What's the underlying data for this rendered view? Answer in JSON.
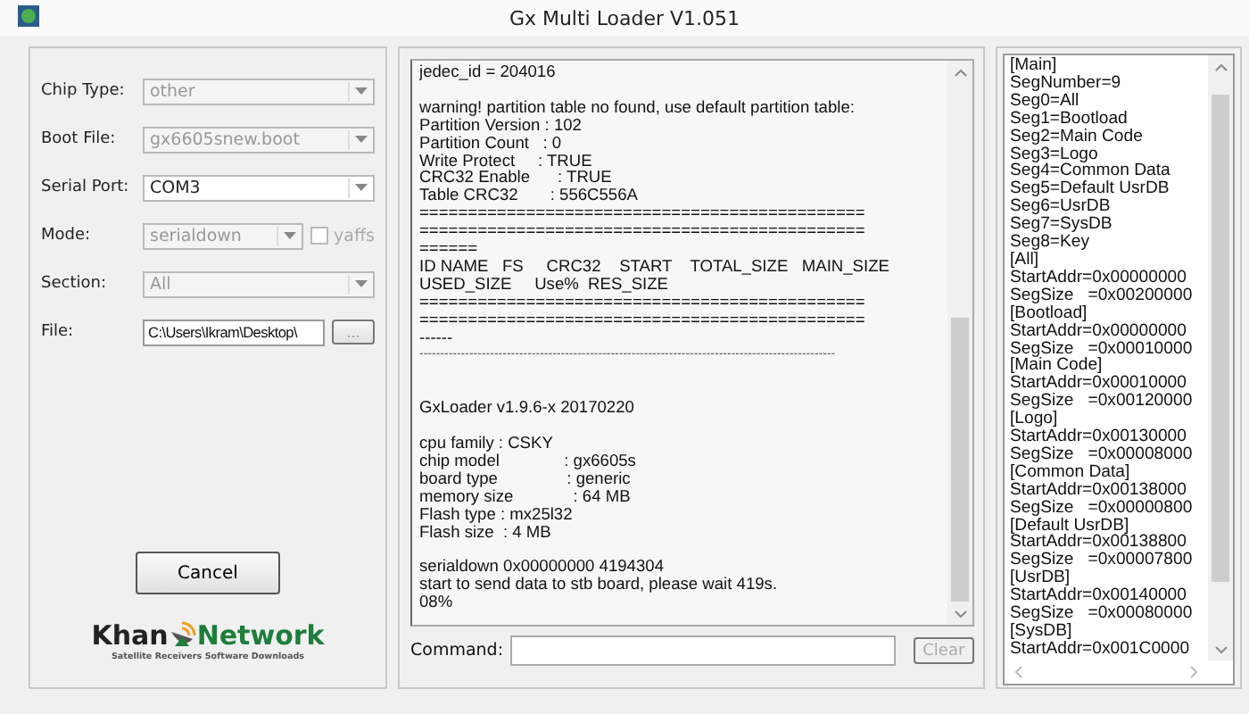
{
  "window": {
    "title": "Gx Multi Loader V1.051"
  },
  "settings": {
    "fields": [
      {
        "kind": "combo",
        "label": "Chip Type:",
        "value": "other",
        "disabled": true
      },
      {
        "kind": "combo",
        "label": "Boot File:",
        "value": "gx6605snew.boot",
        "disabled": true
      },
      {
        "kind": "combo",
        "label": "Serial Port:",
        "value": "COM3",
        "disabled": false
      },
      {
        "kind": "combo",
        "label": "Mode:",
        "value": "serialdown",
        "disabled": true,
        "checkbox": {
          "label": "yaffs",
          "checked": false,
          "disabled": true
        }
      },
      {
        "kind": "combo",
        "label": "Section:",
        "value": "All",
        "disabled": true
      },
      {
        "kind": "file",
        "label": "File:",
        "value": "C:\\Users\\Ikram\\Desktop\\",
        "button": "..."
      }
    ],
    "cancel_button": "Cancel",
    "logo": {
      "word1": "Khan",
      "word2": "Network",
      "tagline": "Satellite Receivers Software Downloads"
    }
  },
  "log": {
    "lines": [
      {
        "kind": "text",
        "text": "jedec_id = 204016"
      },
      {
        "kind": "blank"
      },
      {
        "kind": "text",
        "text": "warning! partition table no found, use default partition table:"
      },
      {
        "kind": "text",
        "text": "Partition Version : 102"
      },
      {
        "kind": "text",
        "text": "Partition Count   : 0"
      },
      {
        "kind": "text",
        "text": "Write Protect     : TRUE"
      },
      {
        "kind": "text",
        "text": "CRC32 Enable      : TRUE"
      },
      {
        "kind": "text",
        "text": "Table CRC32       : 556C556A"
      },
      {
        "kind": "text",
        "text": "=============================================="
      },
      {
        "kind": "text",
        "text": "=============================================="
      },
      {
        "kind": "text",
        "text": "======"
      },
      {
        "kind": "text",
        "text": "ID NAME   FS     CRC32    START    TOTAL_SIZE   MAIN_SIZE"
      },
      {
        "kind": "text",
        "text": "USED_SIZE     Use%  RES_SIZE"
      },
      {
        "kind": "text",
        "text": "=============================================="
      },
      {
        "kind": "text",
        "text": "=============================================="
      },
      {
        "kind": "text",
        "text": "------"
      },
      {
        "kind": "rule",
        "text": "----------------------------------------------------------------------------------------------------"
      },
      {
        "kind": "blank"
      },
      {
        "kind": "blank"
      },
      {
        "kind": "text",
        "text": "GxLoader v1.9.6-x 20170220"
      },
      {
        "kind": "blank"
      },
      {
        "kind": "text",
        "text": "cpu family : CSKY"
      },
      {
        "kind": "text",
        "text": "chip model              : gx6605s"
      },
      {
        "kind": "text",
        "text": "board type               : generic"
      },
      {
        "kind": "text",
        "text": "memory size             : 64 MB"
      },
      {
        "kind": "text",
        "text": "Flash type : mx25l32"
      },
      {
        "kind": "text",
        "text": "Flash size  : 4 MB"
      },
      {
        "kind": "blank"
      },
      {
        "kind": "text",
        "text": "serialdown 0x00000000 4194304"
      },
      {
        "kind": "text",
        "text": "start to send data to stb board, please wait 419s."
      },
      {
        "kind": "text",
        "text": "08%"
      }
    ],
    "command": {
      "label": "Command:",
      "button": "Clear",
      "button_disabled": true
    }
  },
  "config": {
    "lines": [
      "[Main]",
      "SegNumber=9",
      "Seg0=All",
      "Seg1=Bootload",
      "Seg2=Main Code",
      "Seg3=Logo",
      "Seg4=Common Data",
      "Seg5=Default UsrDB",
      "Seg6=UsrDB",
      "Seg7=SysDB",
      "Seg8=Key",
      "[All]",
      "StartAddr=0x00000000",
      "SegSize   =0x00200000",
      "[Bootload]",
      "StartAddr=0x00000000",
      "SegSize   =0x00010000",
      "[Main Code]",
      "StartAddr=0x00010000",
      "SegSize   =0x00120000",
      "[Logo]",
      "StartAddr=0x00130000",
      "SegSize   =0x00008000",
      "[Common Data]",
      "StartAddr=0x00138000",
      "SegSize   =0x00000800",
      "[Default UsrDB]",
      "StartAddr=0x00138800",
      "SegSize   =0x00007800",
      "[UsrDB]",
      "StartAddr=0x00140000",
      "SegSize   =0x00080000",
      "[SysDB]",
      "StartAddr=0x001C0000"
    ]
  }
}
